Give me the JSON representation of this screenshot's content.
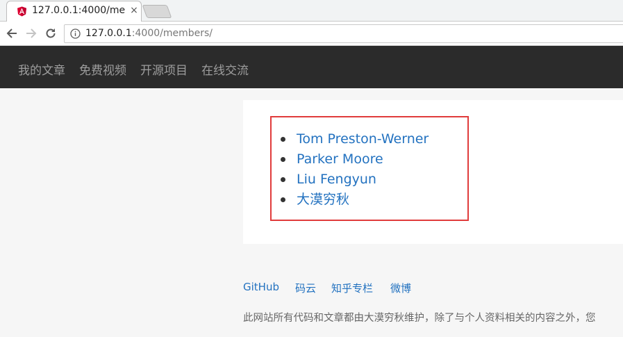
{
  "browser": {
    "tab_title": "127.0.0.1:4000/me",
    "tab_close": "×",
    "url_host": "127.0.0.1",
    "url_rest": ":4000/members/"
  },
  "site_nav": {
    "items": [
      "我的文章",
      "免费视频",
      "开源项目",
      "在线交流"
    ]
  },
  "members": {
    "items": [
      "Tom Preston-Werner",
      "Parker Moore",
      "Liu Fengyun",
      "大漠穷秋"
    ]
  },
  "footer": {
    "links": [
      "GitHub",
      "码云",
      "知乎专栏",
      "微博"
    ],
    "note": "此网站所有代码和文章都由大漠穷秋维护，除了与个人资料相关的内容之外，您"
  },
  "colors": {
    "navbar_bg": "#2b2b2b",
    "link": "#2372c0",
    "highlight_border": "#e03b3b"
  },
  "icons": {
    "favicon": "angular-logo-icon",
    "back": "back-arrow-icon",
    "forward": "forward-arrow-icon",
    "reload": "reload-icon",
    "info": "info-icon"
  }
}
